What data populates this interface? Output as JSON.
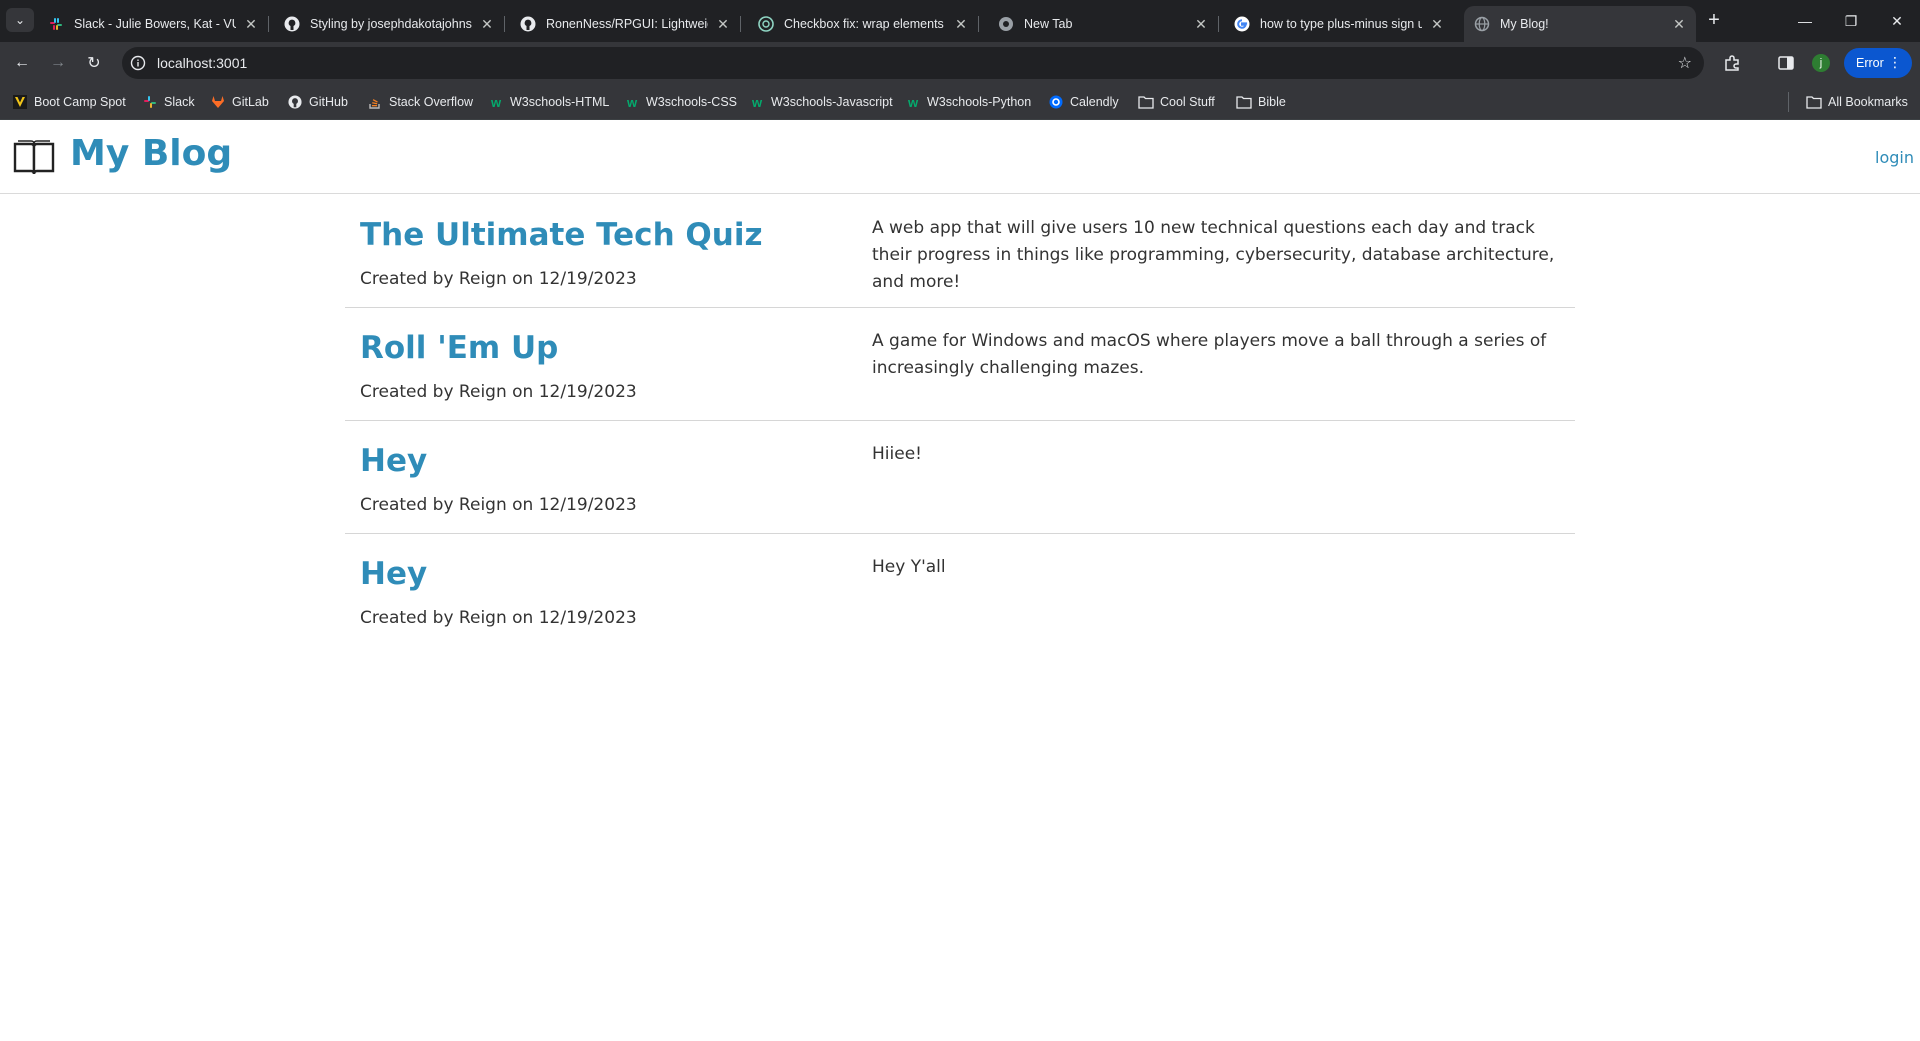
{
  "browser": {
    "tabs": [
      {
        "title": "Slack - Julie Bowers, Kat - VU-V",
        "icon": "slack-icon"
      },
      {
        "title": "Styling by josephdakotajohnson",
        "icon": "github-icon"
      },
      {
        "title": "RonenNess/RPGUI: Lightweight",
        "icon": "github-icon"
      },
      {
        "title": "Checkbox fix: wrap elements",
        "icon": "chatgpt-icon"
      },
      {
        "title": "New Tab",
        "icon": "chrome-icon"
      },
      {
        "title": "how to type plus-minus sign up",
        "icon": "google-icon"
      },
      {
        "title": "My Blog!",
        "icon": "globe-icon",
        "active": true
      }
    ],
    "url": "localhost:3001",
    "error_label": "Error",
    "profile_initial": "j",
    "bookmarks": [
      {
        "label": "Boot Camp Spot",
        "icon": "bootcamp-icon"
      },
      {
        "label": "Slack",
        "icon": "slack-icon"
      },
      {
        "label": "GitLab",
        "icon": "gitlab-icon"
      },
      {
        "label": "GitHub",
        "icon": "github-icon"
      },
      {
        "label": "Stack Overflow",
        "icon": "stackoverflow-icon"
      },
      {
        "label": "W3schools-HTML",
        "icon": "w3schools-icon"
      },
      {
        "label": "W3schools-CSS",
        "icon": "w3schools-icon"
      },
      {
        "label": "W3schools-Javascript",
        "icon": "w3schools-icon"
      },
      {
        "label": "W3schools-Python",
        "icon": "w3schools-icon"
      },
      {
        "label": "Calendly",
        "icon": "calendly-icon"
      },
      {
        "label": "Cool Stuff",
        "icon": "folder-icon"
      },
      {
        "label": "Bible",
        "icon": "folder-icon"
      }
    ],
    "all_bookmarks_label": "All Bookmarks"
  },
  "site": {
    "title": "My Blog",
    "login_label": "login",
    "accent_color": "#2f8cb8"
  },
  "posts": [
    {
      "title": "The Ultimate Tech Quiz",
      "meta": "Created by Reign on 12/19/2023",
      "body": "A web app that will give users 10 new technical questions each day and track their progress in things like programming, cybersecurity, database architecture, and more!"
    },
    {
      "title": "Roll 'Em Up",
      "meta": "Created by Reign on 12/19/2023",
      "body": "A game for Windows and macOS where players move a ball through a series of increasingly challenging mazes."
    },
    {
      "title": "Hey",
      "meta": "Created by Reign on 12/19/2023",
      "body": "Hiiee!"
    },
    {
      "title": "Hey",
      "meta": "Created by Reign on 12/19/2023",
      "body": "Hey Y'all"
    }
  ]
}
